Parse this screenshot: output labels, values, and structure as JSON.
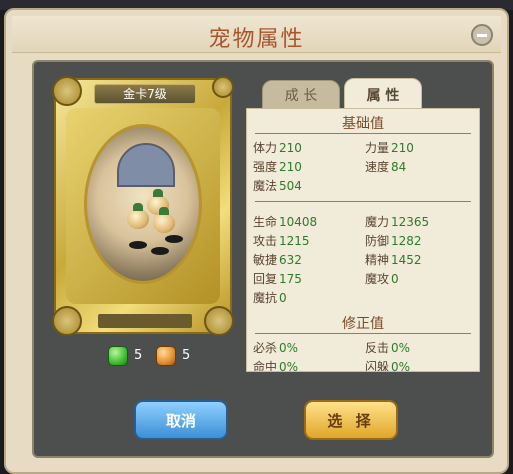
{
  "window": {
    "title": "宠物属性"
  },
  "card": {
    "banner": "金卡7级"
  },
  "gems": [
    {
      "count": "5",
      "color": "#3fbf2f"
    },
    {
      "count": "5",
      "color": "#e48f2c"
    }
  ],
  "tabs": {
    "growth": "成 长",
    "attributes": "属 性"
  },
  "sections": {
    "base": "基础值",
    "modifier": "修正值"
  },
  "base_stats": [
    {
      "label": "体力",
      "value": "210"
    },
    {
      "label": "力量",
      "value": "210"
    },
    {
      "label": "强度",
      "value": "210"
    },
    {
      "label": "速度",
      "value": "84"
    },
    {
      "label": "魔法",
      "value": "504"
    }
  ],
  "derived_stats": [
    {
      "label": "生命",
      "value": "10408"
    },
    {
      "label": "魔力",
      "value": "12365"
    },
    {
      "label": "攻击",
      "value": "1215"
    },
    {
      "label": "防御",
      "value": "1282"
    },
    {
      "label": "敏捷",
      "value": "632"
    },
    {
      "label": "精神",
      "value": "1452"
    },
    {
      "label": "回复",
      "value": "175"
    },
    {
      "label": "魔攻",
      "value": "0"
    },
    {
      "label": "魔抗",
      "value": "0"
    }
  ],
  "modifier_stats": [
    {
      "label": "必杀",
      "value": "0%"
    },
    {
      "label": "反击",
      "value": "0%"
    },
    {
      "label": "命中",
      "value": "0%"
    },
    {
      "label": "闪躲",
      "value": "0%"
    }
  ],
  "buttons": {
    "cancel": "取消",
    "select": "选 择"
  }
}
